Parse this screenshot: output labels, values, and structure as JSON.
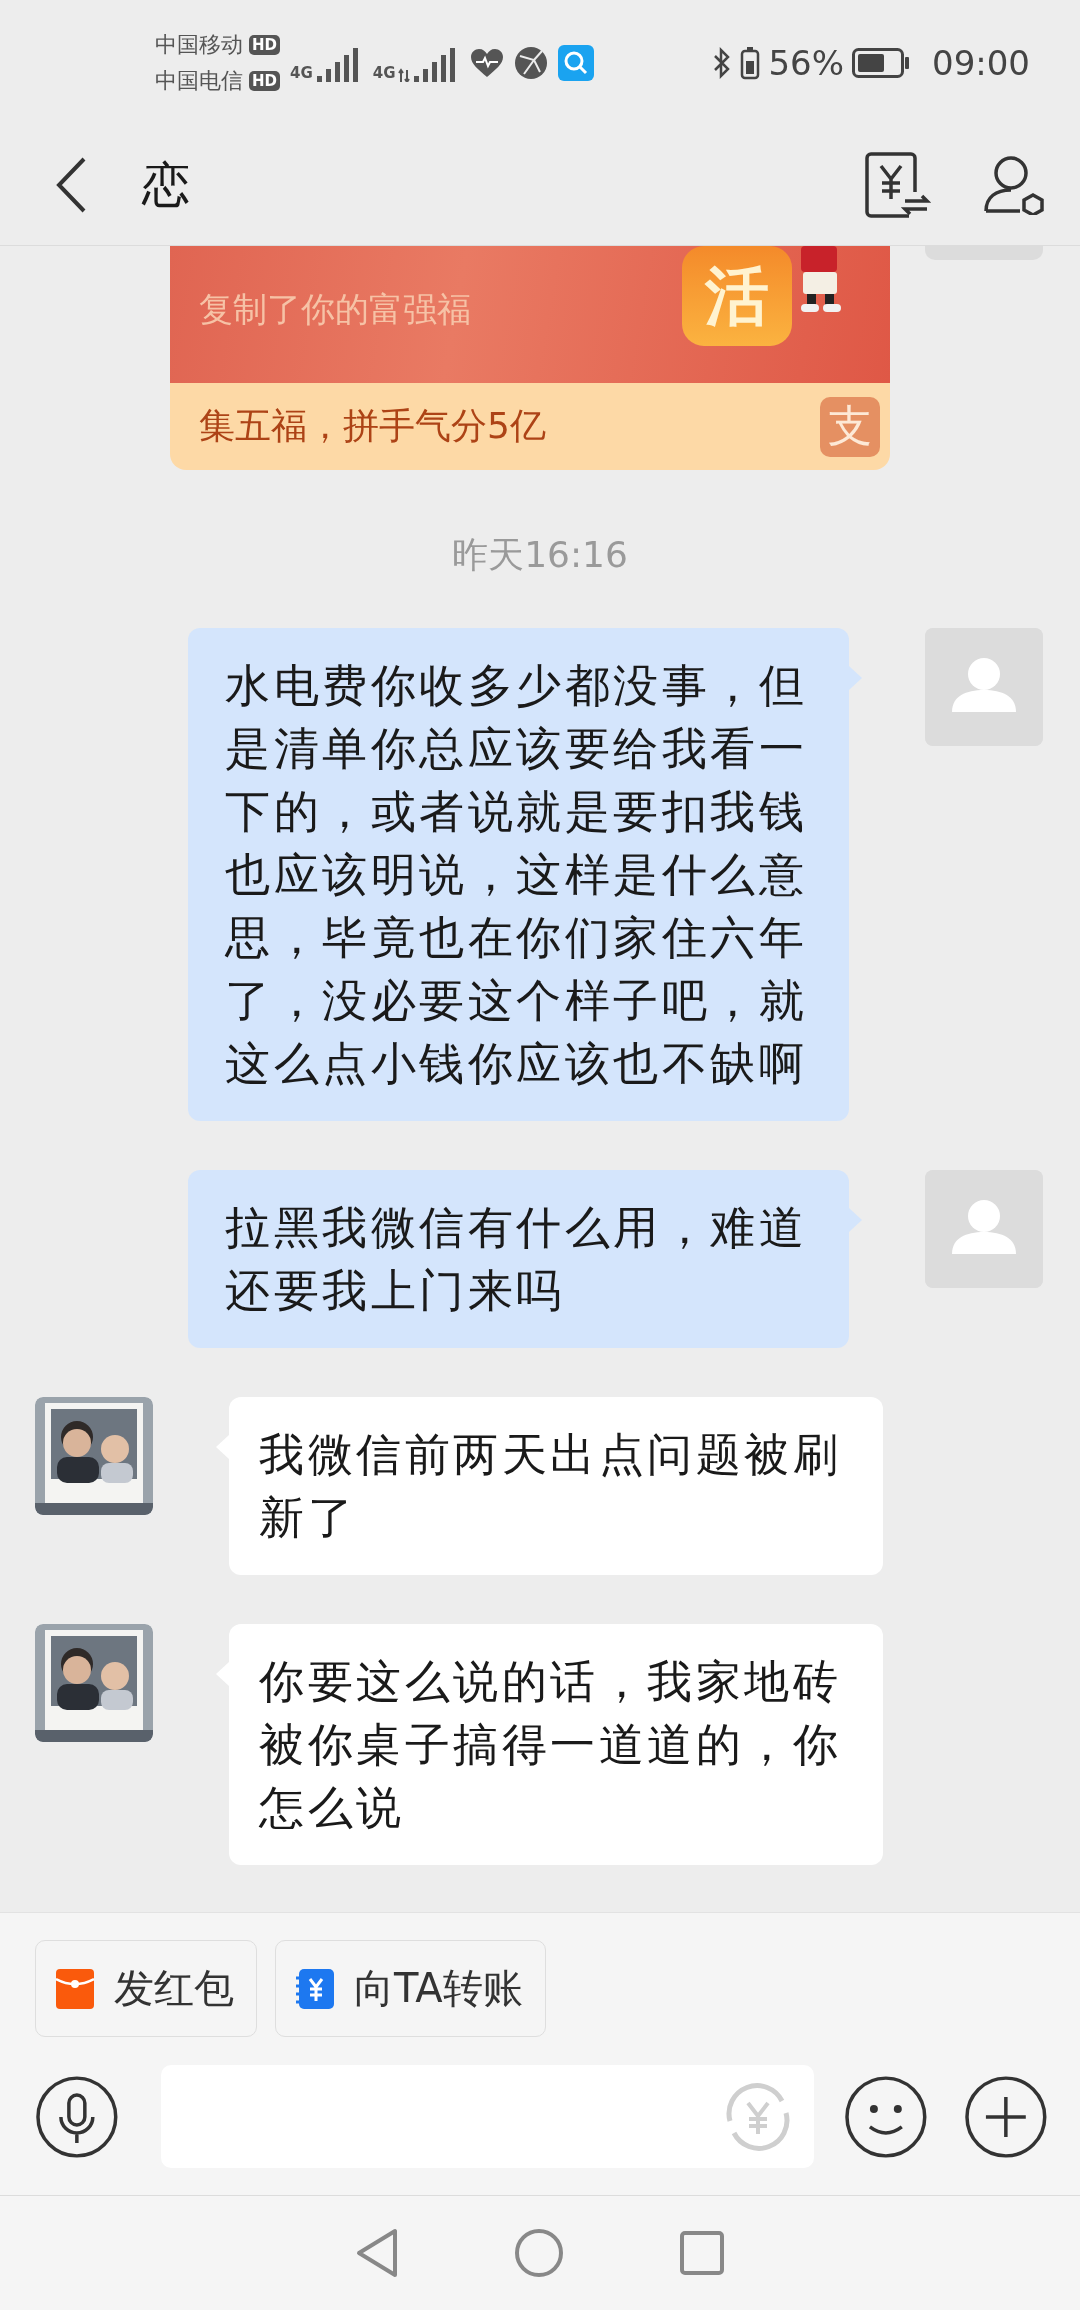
{
  "status_bar": {
    "carriers": [
      {
        "name": "中国移动",
        "badge": "HD"
      },
      {
        "name": "中国电信",
        "badge": "HD"
      }
    ],
    "networks": [
      "4G",
      "4G"
    ],
    "battery_text": "56%",
    "time": "09:00"
  },
  "header": {
    "title": "恋"
  },
  "card": {
    "tile_text": "活",
    "subtitle": "复制了你的富强福",
    "footer": "集五福，拼手气分5亿",
    "logo_text": "支"
  },
  "timestamp": "昨天16:16",
  "messages": [
    {
      "kind": "outgoing",
      "text": "水电费你收多少都没事，但是清单你总应该要给我看一下的，或者说就是要扣我钱也应该明说，这样是什么意思，毕竟也在你们家住六年了，没必要这个样子吧，就这么点小钱你应该也不缺啊"
    },
    {
      "kind": "outgoing",
      "text": "拉黑我微信有什么用，难道还要我上门来吗"
    },
    {
      "kind": "incoming",
      "text": "我微信前两天出点问题被刷新了"
    },
    {
      "kind": "incoming",
      "text": "你要这么说的话，我家地砖被你桌子搞得一道道的，你怎么说"
    }
  ],
  "quick_actions": [
    {
      "kind": "red_packet",
      "label": "发红包"
    },
    {
      "kind": "transfer",
      "label": "向TA转账"
    }
  ]
}
